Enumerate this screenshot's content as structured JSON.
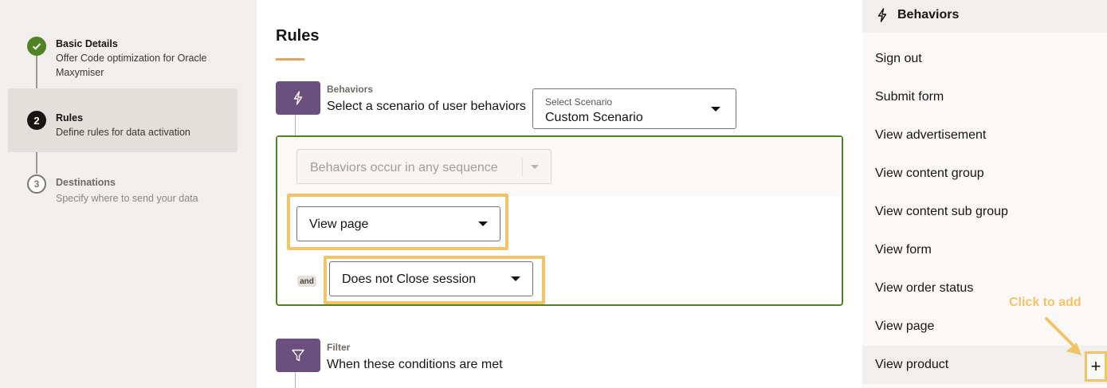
{
  "stepper": {
    "steps": [
      {
        "number": "",
        "status": "done",
        "title": "Basic Details",
        "description": "Offer Code optimization for Oracle Maxymiser"
      },
      {
        "number": "2",
        "status": "current",
        "title": "Rules",
        "description": "Define rules for data activation"
      },
      {
        "number": "3",
        "status": "todo",
        "title": "Destinations",
        "description": "Specify where to send your data"
      }
    ]
  },
  "main": {
    "title": "Rules",
    "behaviors_section": {
      "label": "Behaviors",
      "description": "Select a scenario of user behaviors",
      "icon": "lightning-icon",
      "scenario_select": {
        "label": "Select Scenario",
        "value": "Custom Scenario"
      }
    },
    "rule_card": {
      "sequence_select": {
        "value": "Behaviors occur in any sequence",
        "disabled": true
      },
      "behavior_1": {
        "value": "View page"
      },
      "connector": "and",
      "behavior_2": {
        "value": "Does not Close session"
      }
    },
    "filter_section": {
      "label": "Filter",
      "description": "When these conditions are met",
      "icon": "filter-icon"
    }
  },
  "panel": {
    "title": "Behaviors",
    "icon": "lightning-icon",
    "items": [
      {
        "label": "Sign out"
      },
      {
        "label": "Submit form"
      },
      {
        "label": "View advertisement"
      },
      {
        "label": "View content group"
      },
      {
        "label": "View content sub group"
      },
      {
        "label": "View form"
      },
      {
        "label": "View order status"
      },
      {
        "label": "View page"
      },
      {
        "label": "View product"
      }
    ],
    "add_button_label": "+"
  },
  "callout": {
    "text": "Click to add"
  },
  "colors": {
    "accent_purple": "#6b4f7f",
    "success_green": "#508223",
    "highlight_yellow": "#f2c468",
    "title_underline": "#e4a35d"
  }
}
